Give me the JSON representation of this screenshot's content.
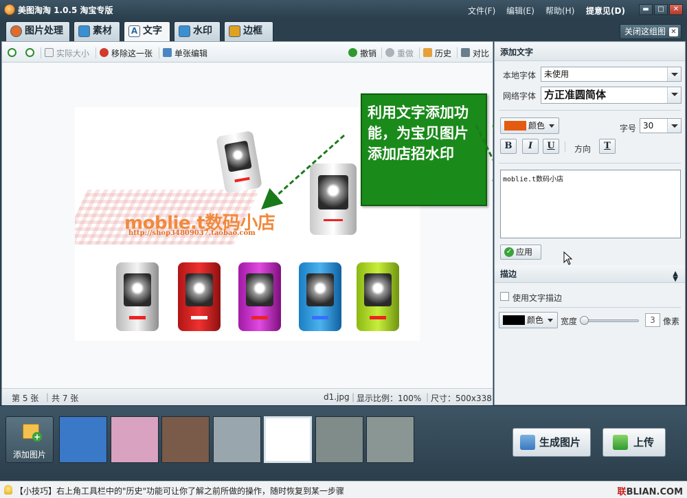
{
  "window": {
    "title": "美图淘淘 1.0.5 淘宝专版",
    "menus": [
      "文件(F)",
      "编辑(E)",
      "帮助(H)",
      "提意见(D)"
    ],
    "controls": [
      "▬",
      "□",
      "✕"
    ]
  },
  "tabs": [
    {
      "label": "图片处理",
      "icon": "palette-icon",
      "color": "#e36b2a"
    },
    {
      "label": "素材",
      "icon": "material-icon",
      "color": "#3a8fd0"
    },
    {
      "label": "文字",
      "icon": "text-icon",
      "color": "#2b6aa0",
      "active": true
    },
    {
      "label": "水印",
      "icon": "watermark-icon",
      "color": "#3a8fd0"
    },
    {
      "label": "边框",
      "icon": "frame-icon",
      "color": "#e0a020"
    }
  ],
  "close_group": {
    "label": "关闭这组图",
    "x": "✕"
  },
  "toolbar": {
    "actual_size": "实际大小",
    "remove_this": "移除这一张",
    "single_edit": "单张编辑",
    "undo": "撤销",
    "redo": "重做",
    "history": "历史",
    "compare": "对比"
  },
  "callout": {
    "text": "利用文字添加功能，为宝贝图片添加店招水印"
  },
  "photo": {
    "watermark": "moblie.t数码小店",
    "url": "http://shop34809037.taobao.com"
  },
  "status": {
    "index": "第 5 张",
    "total": "共 7 张",
    "filename": "d1.jpg",
    "zoom": "显示比例：100%",
    "size": "尺寸：500x338"
  },
  "text_panel": {
    "title": "添加文字",
    "local_font_label": "本地字体",
    "local_font_value": "未使用",
    "web_font_label": "网络字体",
    "web_font_value": "方正准圆简体",
    "color_label": "颜色",
    "text_color": "#e35a10",
    "font_size_label": "字号",
    "font_size_value": "30",
    "bold": "B",
    "italic": "I",
    "underline": "U",
    "direction_label": "方向",
    "direction_icon": "T",
    "text_content": "moblie.t数码小店",
    "apply_label": "应用"
  },
  "stroke_panel": {
    "title": "描边",
    "use_stroke_label": "使用文字描边",
    "color_label": "颜色",
    "stroke_color": "#000000",
    "width_label": "宽度",
    "width_value": "3",
    "unit_label": "像素"
  },
  "thumbbar": {
    "add_label": "添加图片",
    "generate_label": "生成图片",
    "upload_label": "上传",
    "thumbs": [
      {
        "bg": "#3a78c8",
        "sel": false
      },
      {
        "bg": "#d8a2c0",
        "sel": false
      },
      {
        "bg": "#7a5a48",
        "sel": false
      },
      {
        "bg": "#9aa6ae",
        "sel": false
      },
      {
        "bg": "#ffffff",
        "sel": true
      },
      {
        "bg": "#7f8c8a",
        "sel": false
      },
      {
        "bg": "#8a9694",
        "sel": false
      }
    ]
  },
  "tip": {
    "text": "【小技巧】右上角工具栏中的\"历史\"功能可让你了解之前所做的操作，随时恢复到某一步骤"
  },
  "watermark_logo": {
    "a": "联",
    "b": "BLIAN.COM"
  }
}
